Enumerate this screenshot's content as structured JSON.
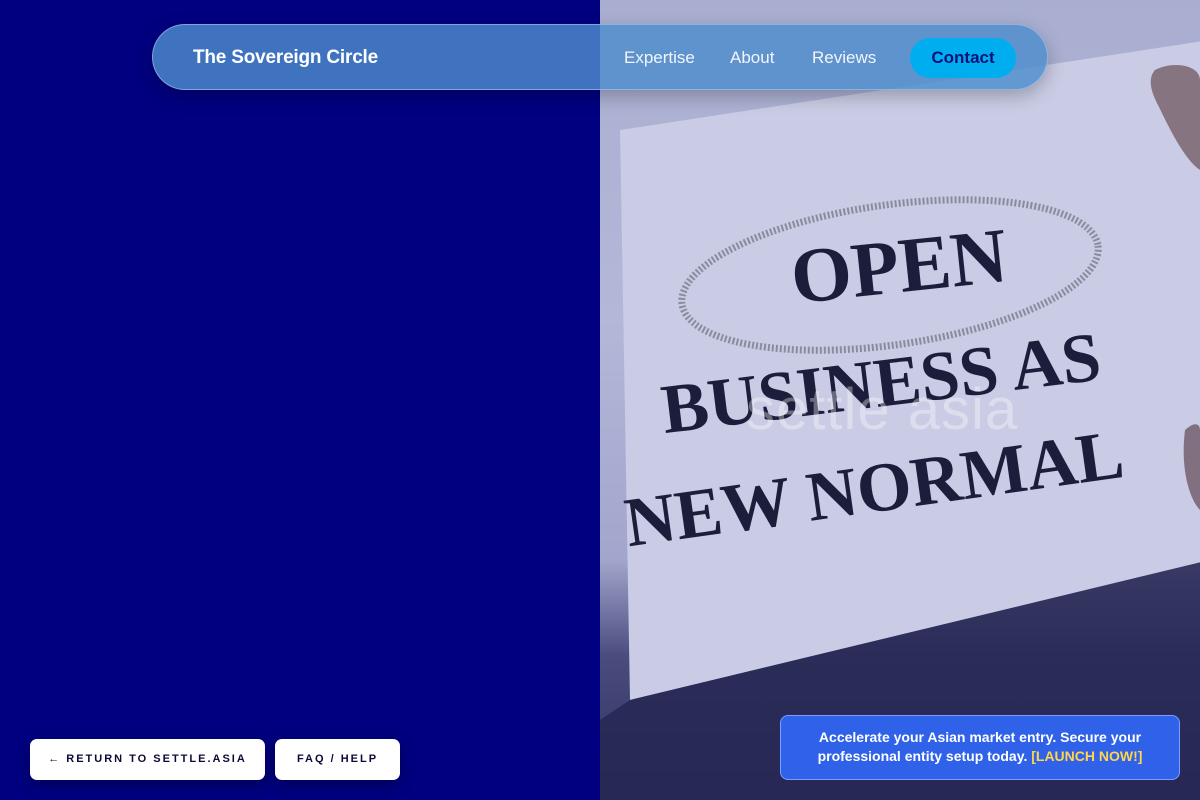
{
  "brand": {
    "name": "The Sovereign Circle"
  },
  "nav": {
    "links": [
      "Expertise",
      "About",
      "Reviews"
    ],
    "contact_label": "Contact"
  },
  "hero_image": {
    "sign_lines": [
      "OPEN",
      "BUSINESS AS",
      "NEW NORMAL"
    ],
    "watermark": "settle asia"
  },
  "footer_buttons": {
    "return_label": "← RETURN TO SETTLE.ASIA",
    "faq_label": "FAQ / HELP"
  },
  "promo": {
    "text": "Accelerate your Asian market entry. Secure your professional entity setup today.",
    "cta": "[LAUNCH NOW!]"
  },
  "colors": {
    "left_background": "#000080",
    "nav_background": "#4d8ccd",
    "contact_button": "#00aef0",
    "promo_background": "#2f62e8",
    "promo_cta": "#ffd54a"
  }
}
